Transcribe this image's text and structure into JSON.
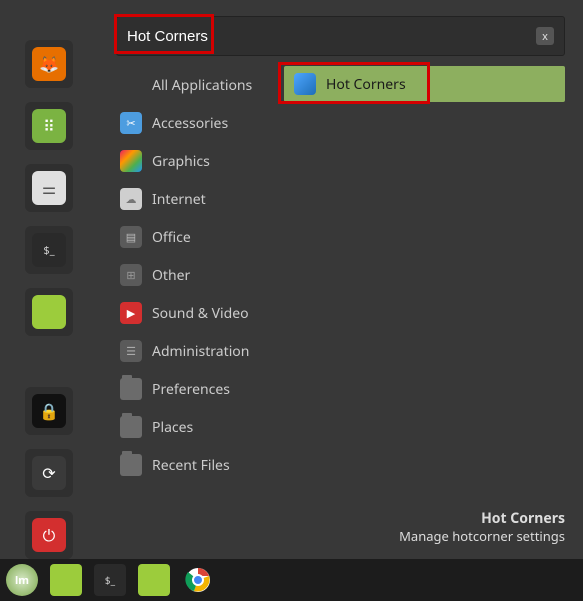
{
  "search": {
    "value": "Hot Corners",
    "clear": "x"
  },
  "favorites": [
    {
      "name": "firefox",
      "bg": "bg-orange",
      "glyph": "◐"
    },
    {
      "name": "apps-grid",
      "bg": "bg-green",
      "glyph": "⊞"
    },
    {
      "name": "settings-toggle",
      "bg": "bg-lightg",
      "glyph": "≣"
    },
    {
      "name": "terminal",
      "bg": "bg-dark",
      "glyph": "$_"
    },
    {
      "name": "files",
      "bg": "bg-lime",
      "glyph": ""
    }
  ],
  "session": [
    {
      "name": "lock",
      "bg": "bg-black",
      "glyph": "🔒"
    },
    {
      "name": "logout",
      "bg": "bg-grey",
      "glyph": "⟳"
    },
    {
      "name": "power",
      "bg": "bg-red",
      "glyph": "⏻"
    }
  ],
  "categories": [
    {
      "label": "All Applications",
      "icon": "",
      "icon_bg": ""
    },
    {
      "label": "Accessories",
      "icon": "✂",
      "icon_bg": "background:#4d9de0;color:#fff;"
    },
    {
      "label": "Graphics",
      "icon": "◧",
      "icon_bg": "background:linear-gradient(135deg,#e91e63,#ff9800,#4caf50);"
    },
    {
      "label": "Internet",
      "icon": "☁",
      "icon_bg": "background:#bdbdbd;color:#666;"
    },
    {
      "label": "Office",
      "icon": "▤",
      "icon_bg": "background:#606060;color:#ddd;"
    },
    {
      "label": "Other",
      "icon": "⊞",
      "icon_bg": "background:#606060;color:#aaa;"
    },
    {
      "label": "Sound & Video",
      "icon": "▶",
      "icon_bg": "background:#d32f2f;color:#fff;"
    },
    {
      "label": "Administration",
      "icon": "☰",
      "icon_bg": "background:#606060;color:#aaa;"
    },
    {
      "label": "Preferences",
      "icon": "",
      "icon_bg": ""
    },
    {
      "label": "Places",
      "icon": "",
      "icon_bg": ""
    },
    {
      "label": "Recent Files",
      "icon": "",
      "icon_bg": ""
    }
  ],
  "result": {
    "label": "Hot Corners"
  },
  "description": {
    "title": "Hot Corners",
    "subtitle": "Manage hotcorner settings"
  },
  "panel": [
    {
      "name": "mint-menu",
      "glyph": "lm"
    },
    {
      "name": "files-pinned",
      "glyph": "folder"
    },
    {
      "name": "terminal-pinned",
      "glyph": "term"
    },
    {
      "name": "files2-pinned",
      "glyph": "folder"
    },
    {
      "name": "chrome-pinned",
      "glyph": "chrome"
    }
  ]
}
